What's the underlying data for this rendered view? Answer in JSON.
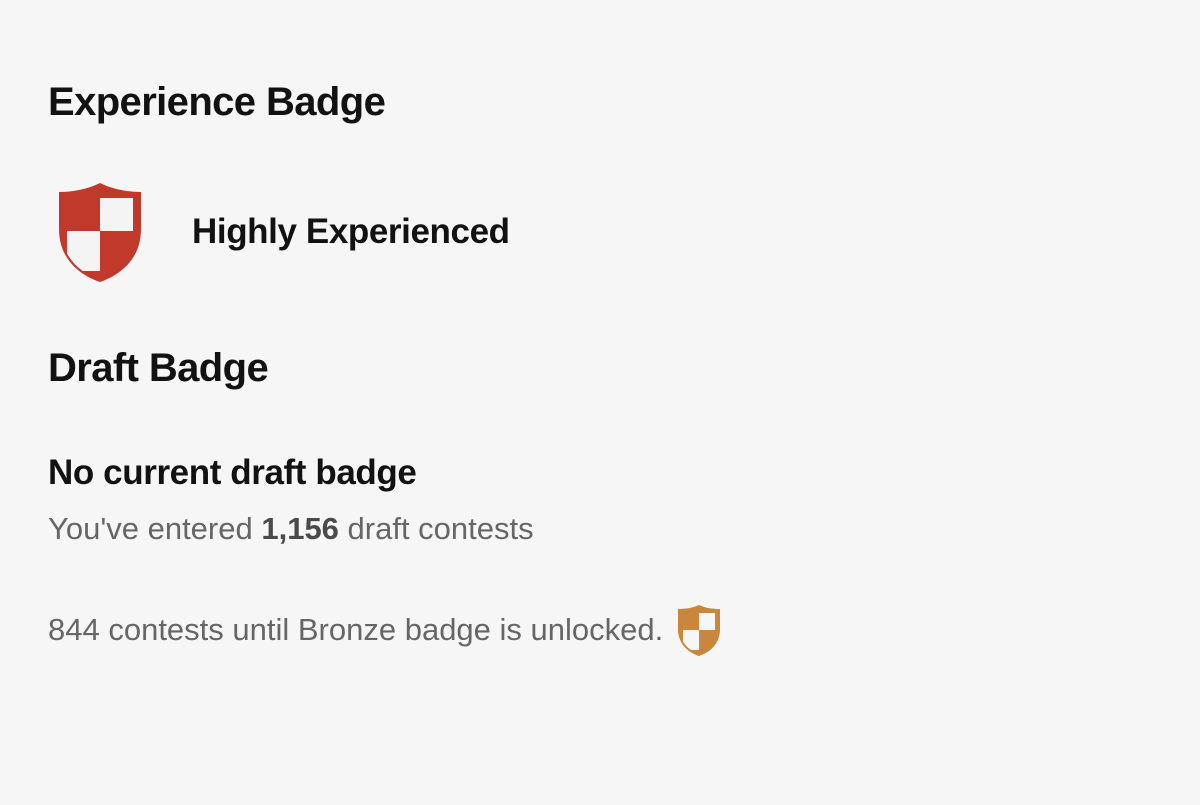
{
  "experience": {
    "title": "Experience Badge",
    "badge_label": "Highly Experienced",
    "badge_icon": "shield-icon",
    "badge_color": "#c0392b"
  },
  "draft": {
    "title": "Draft Badge",
    "status": "No current draft badge",
    "entered_prefix": "You've entered ",
    "entered_count": "1,156",
    "entered_suffix": " draft contests",
    "until_text": "844 contests until Bronze badge is unlocked.",
    "next_badge_icon": "shield-icon",
    "next_badge_color": "#c8873b"
  }
}
